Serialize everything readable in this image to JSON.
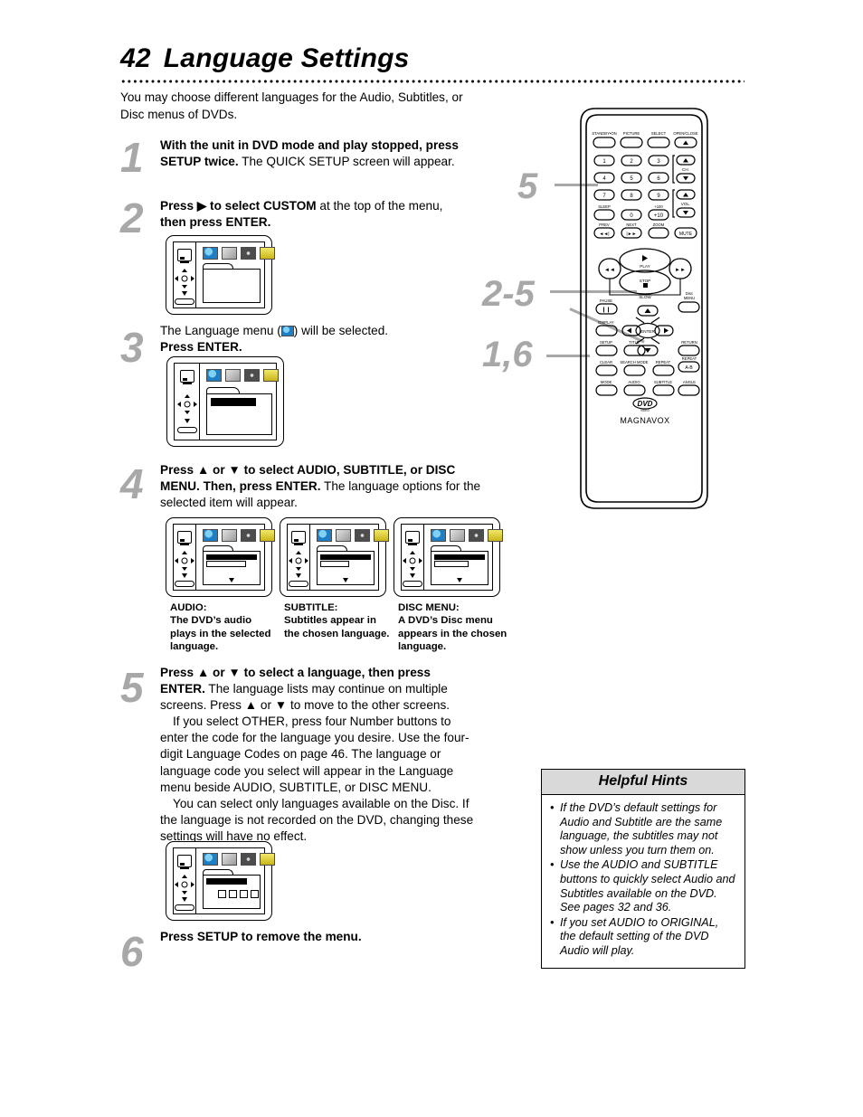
{
  "page": {
    "number": "42",
    "title": "Language Settings",
    "intro": "You may choose different languages for the Audio, Subtitles, or Disc menus of DVDs."
  },
  "steps": [
    {
      "number": "1",
      "html_bold_1": "With the unit in DVD mode and play stopped, press SETUP twice.",
      "rest_1": " The QUICK SETUP screen will appear."
    },
    {
      "number": "2",
      "html_bold_1": "Press ▶ to select CUSTOM",
      "rest_1": " at the top of the menu,",
      "html_bold_2": "then press ENTER."
    },
    {
      "number": "3",
      "lead_plain": "The Language menu (",
      "lead_plain_2": ") will be selected.",
      "html_bold_1": "Press ENTER."
    },
    {
      "number": "4",
      "html_bold_1": "Press ▲ or ▼ to select AUDIO, SUBTITLE, or DISC MENU. Then, press ENTER.",
      "rest_1": " The language options for the selected item will appear."
    },
    {
      "number": "5",
      "html_bold_1": "Press ▲ or ▼ to select a language, then press ENTER.",
      "rest_1": " The language lists may continue on multiple screens. Press ▲ or ▼ to move to the other screens.",
      "para_2": "If you select OTHER, press four Number buttons to enter the code for the language you desire. Use the four-digit Language Codes on page 46. The language or language code you select will appear in the Language menu beside AUDIO, SUBTITLE, or DISC MENU.",
      "para_3": "You can select only languages available on the Disc. If the language is not recorded on the DVD, changing these settings will have no effect."
    },
    {
      "number": "6",
      "html_bold_1": "Press SETUP to remove the menu."
    }
  ],
  "screen_captions": [
    {
      "title": "AUDIO:",
      "text": "The DVD’s audio plays in the selected language."
    },
    {
      "title": "SUBTITLE:",
      "text": "Subtitles appear in the chosen language."
    },
    {
      "title": "DISC MENU:",
      "text": "A DVD’s Disc menu appears in the chosen language."
    }
  ],
  "osd_tabs": [
    {
      "name": "language-tab-icon",
      "color": "#1f7fc4"
    },
    {
      "name": "display-tab-icon",
      "color": "#9a9a9a"
    },
    {
      "name": "audio-tab-icon",
      "color": "#4d4d4d"
    },
    {
      "name": "parental-tab-icon",
      "color": "#c9b51a"
    }
  ],
  "callouts": [
    {
      "label": "5"
    },
    {
      "label": "2-5"
    },
    {
      "label": "1,6"
    }
  ],
  "remote": {
    "brand": "MAGNAVOX",
    "logo": "DVD",
    "logo_sub": "VIDEO",
    "rows": {
      "top_labels": [
        "STANDBY•ON",
        "PICTURE",
        "SELECT",
        "OPEN/CLOSE"
      ],
      "numbers": [
        "1",
        "2",
        "3",
        "4",
        "5",
        "6",
        "7",
        "8",
        "9",
        "0"
      ],
      "ch_label": "CH.",
      "vol_label": "VOL.",
      "sleep": "SLEEP",
      "plus100": "+100",
      "plus10": "+10",
      "prev": "PREV",
      "next": "NEXT",
      "zoom": "ZOOM",
      "mute": "MUTE",
      "play": "PLAY",
      "stop": "STOP",
      "slow": "SLOW",
      "pause": "PAUSE",
      "disc_menu": "Disc MENU",
      "display": "DISPLAY",
      "enter": "ENTER",
      "setup": "SETUP",
      "title": "TITLE",
      "return": "RETURN",
      "clear": "CLEAR",
      "search_mode": "SEARCH MODE",
      "repeat": "REPEAT",
      "repeat_ab": "REPEAT A-B",
      "ab": "A-B",
      "mode": "MODE",
      "audio": "AUDIO",
      "subtitle": "SUBTITLE",
      "angle": "ANGLE"
    }
  },
  "hints": {
    "heading": "Helpful Hints",
    "items": [
      "If the DVD’s default settings for Audio and Subtitle are the same language, the subtitles may not show unless you turn them on.",
      "Use the AUDIO and SUBTITLE buttons to quickly select Audio and Subtitles available on the DVD. See pages 32 and 36.",
      "If you set AUDIO to ORIGINAL, the default setting of the DVD Audio will play."
    ],
    "bullet": "•"
  }
}
